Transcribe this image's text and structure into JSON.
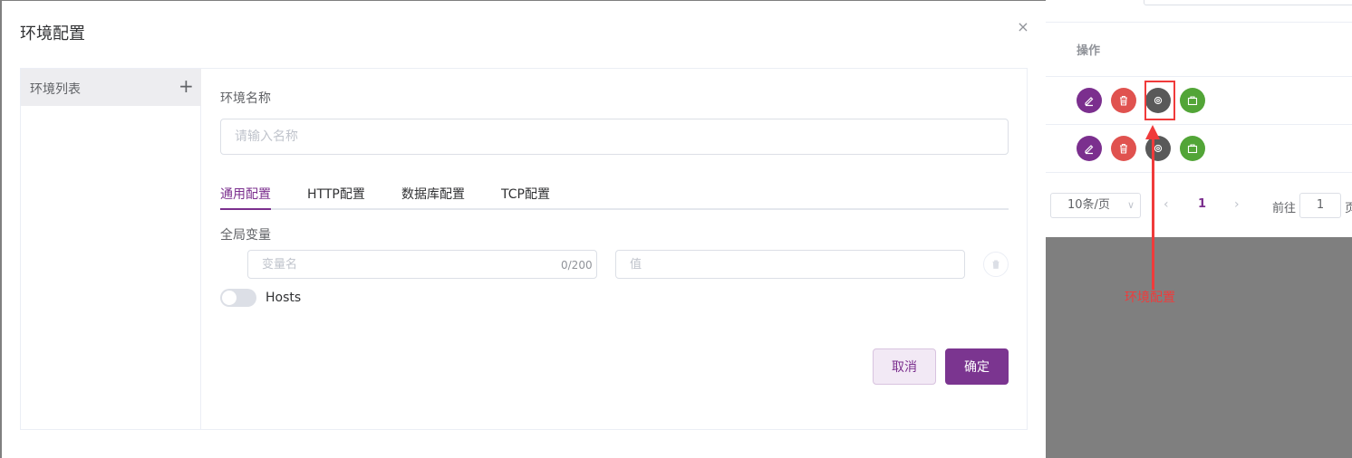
{
  "dialog": {
    "title": "环境配置",
    "close_icon": "×"
  },
  "env_list": {
    "title": "环境列表",
    "add_icon": "+"
  },
  "form": {
    "name_label": "环境名称",
    "name_placeholder": "请输入名称",
    "tabs": [
      {
        "label": "通用配置",
        "active": true
      },
      {
        "label": "HTTP配置",
        "active": false
      },
      {
        "label": "数据库配置",
        "active": false
      },
      {
        "label": "TCP配置",
        "active": false
      }
    ],
    "global_vars_label": "全局变量",
    "var_name_placeholder": "变量名",
    "var_name_counter": "0/200",
    "var_value_placeholder": "值",
    "hosts_label": "Hosts",
    "hosts_enabled": false,
    "cancel_label": "取消",
    "confirm_label": "确定"
  },
  "background": {
    "column_header": "操作",
    "pager": {
      "page_size": "10条/页",
      "prev": "‹",
      "current": "1",
      "next": "›",
      "goto_label": "前往",
      "goto_value": "1",
      "page_suffix": "页"
    },
    "annotation": "环境配置",
    "colors": {
      "purple": "#7b2f8e",
      "red": "#e0524f",
      "gray": "#595959",
      "green": "#52a537",
      "annotation": "#f03b3b"
    }
  }
}
